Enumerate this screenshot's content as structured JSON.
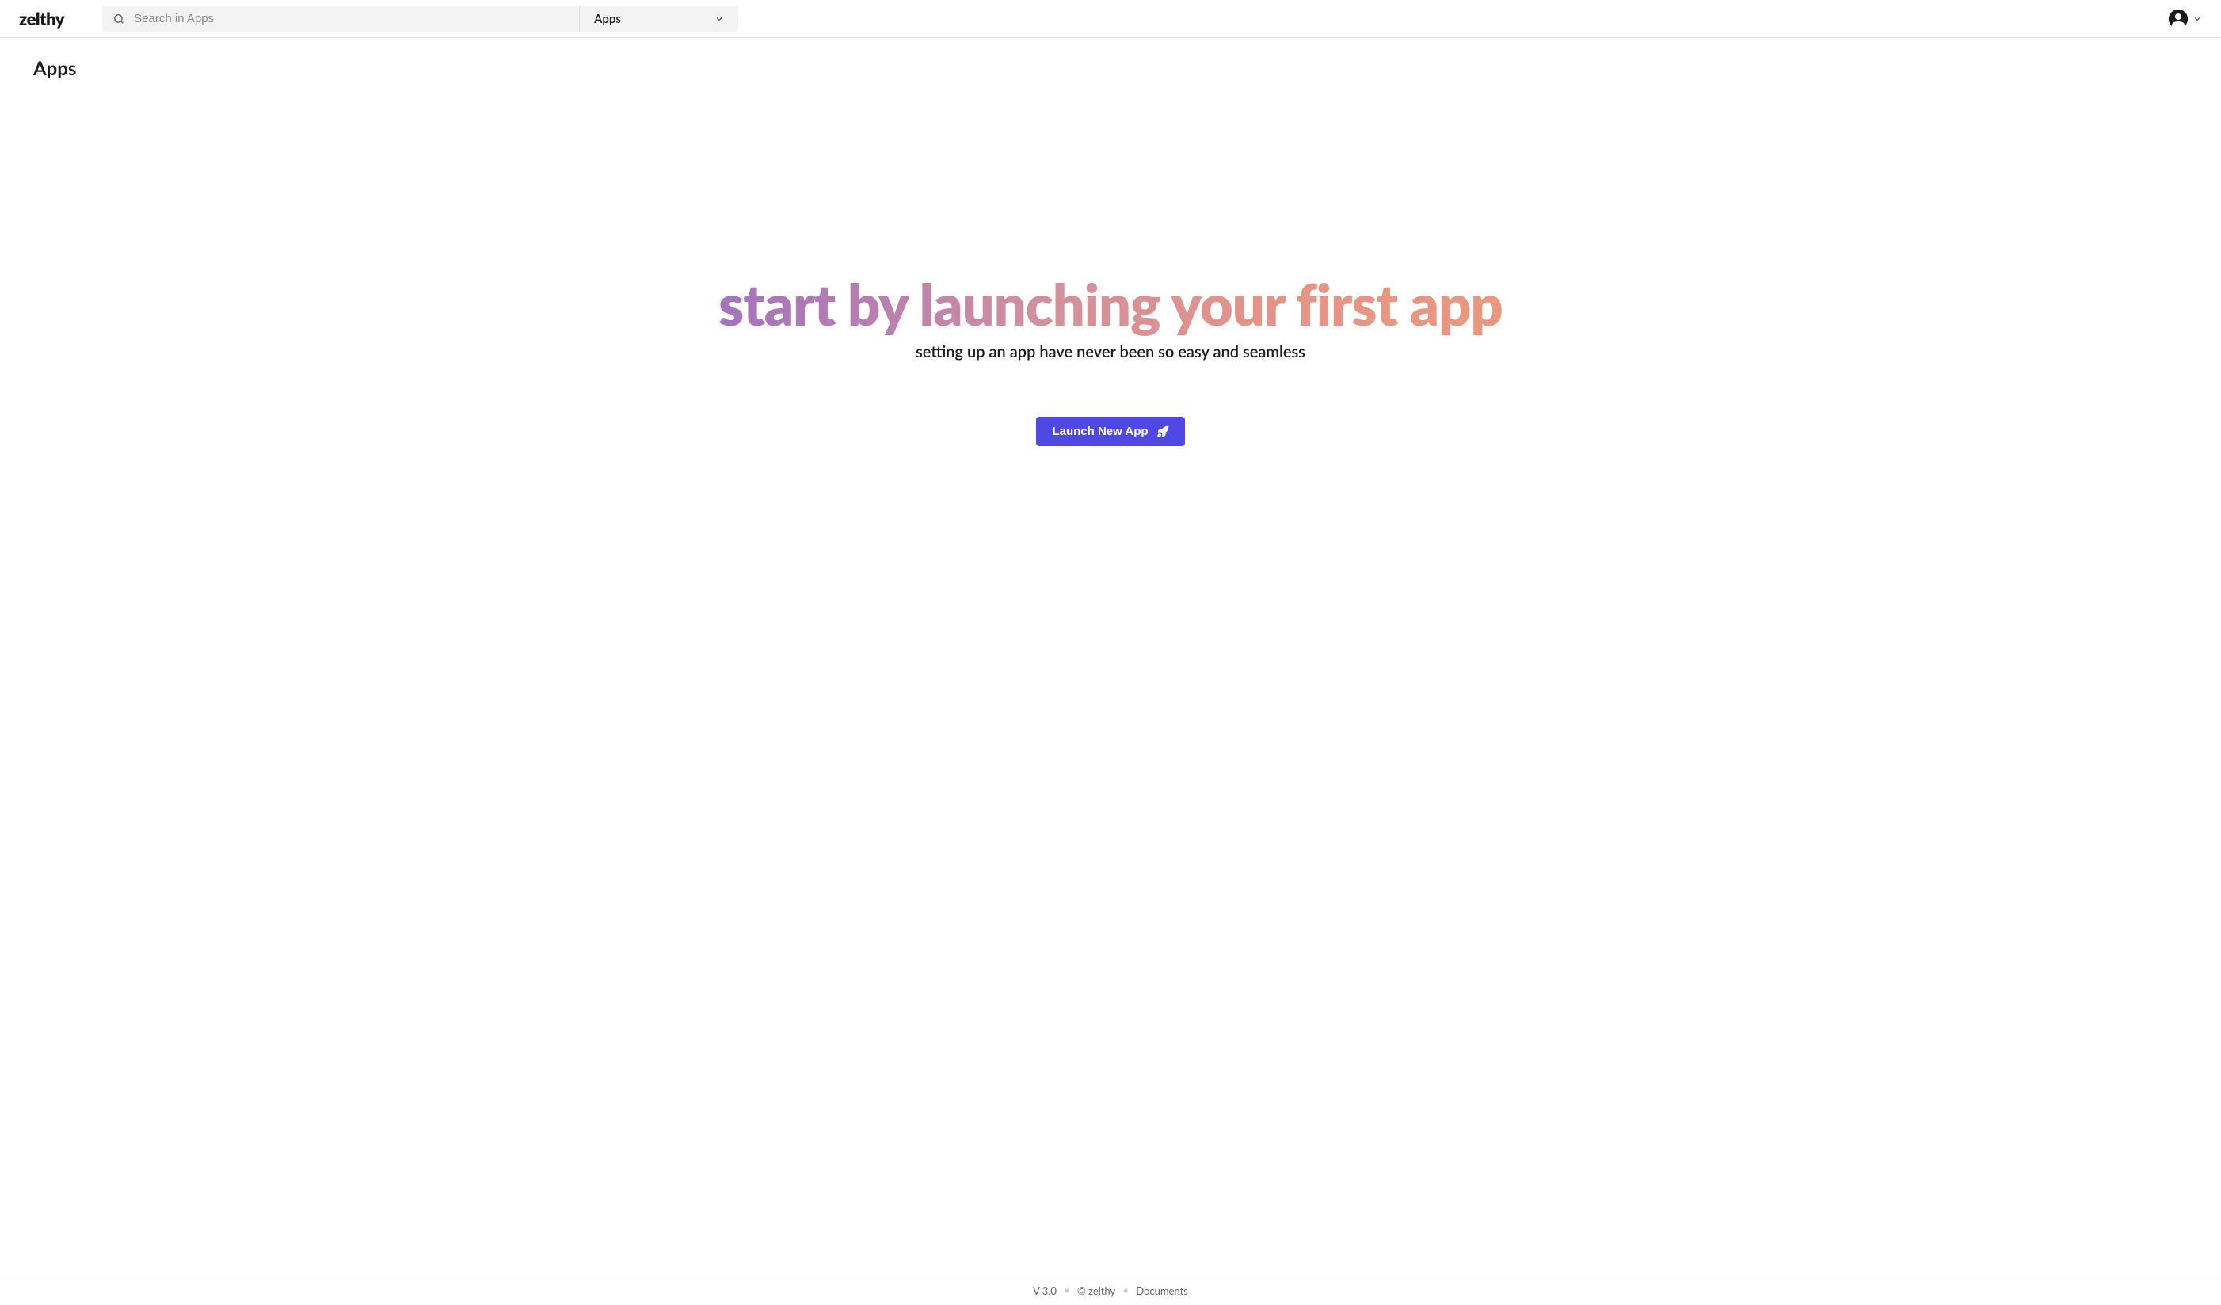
{
  "header": {
    "logo": "zelthy",
    "search_placeholder": "Search in Apps",
    "filter_label": "Apps"
  },
  "page": {
    "title": "Apps"
  },
  "hero": {
    "title": "start by launching your first app",
    "subtitle": "setting up an app have never been so easy and seamless",
    "button_label": "Launch New App"
  },
  "footer": {
    "version": "V 3.0",
    "copyright": "© zelthy",
    "documents_link": "Documents"
  }
}
